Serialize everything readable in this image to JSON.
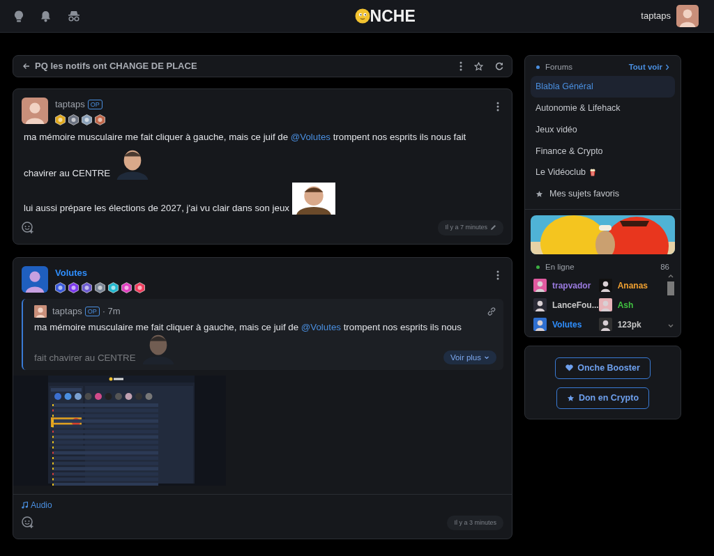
{
  "header": {
    "logo_text": "NCHE",
    "username": "taptaps"
  },
  "topic": {
    "title": "PQ les notifs ont CHANGE DE PLACE"
  },
  "posts": [
    {
      "author": "taptaps",
      "color": "#9ea3ab",
      "op": "OP",
      "badges": [
        {
          "color": "#e0a81c"
        },
        {
          "color": "#6b7280"
        },
        {
          "color": "#8aa0b8"
        },
        {
          "color": "#c0674a"
        }
      ],
      "lines": [
        [
          {
            "kind": "text",
            "text": "ma mémoire musculaire me fait cliquer à gauche, mais ce juif de "
          },
          {
            "kind": "mention",
            "text": "@Volutes"
          },
          {
            "kind": "text",
            "text": " trompent nos esprits ils nous fait"
          }
        ],
        [
          {
            "kind": "text",
            "text": "chavirer au CENTRE"
          },
          {
            "kind": "picture"
          }
        ],
        [
          {
            "kind": "text",
            "text": "lui aussi prépare les élections de 2027, j'ai vu clair dans son jeux"
          },
          {
            "kind": "picture"
          }
        ]
      ],
      "time": "Il y a 7 minutes",
      "edited": true
    },
    {
      "author": "Volutes",
      "color": "#2f8fff",
      "badges": [
        {
          "color": "#3b5bdb"
        },
        {
          "color": "#7c3aed"
        },
        {
          "color": "#6d5bd0"
        },
        {
          "color": "#7a8594"
        },
        {
          "color": "#22b8cf"
        },
        {
          "color": "#e040c0"
        },
        {
          "color": "#f03e5e"
        }
      ],
      "quote": {
        "author": "taptaps",
        "op": "OP",
        "age": "· 7m",
        "lines": [
          [
            {
              "kind": "text",
              "text": "ma mémoire musculaire me fait cliquer à gauche, mais ce juif de "
            },
            {
              "kind": "mention",
              "text": "@Volutes"
            },
            {
              "kind": "text",
              "text": " trompent nos esprits ils nous"
            }
          ],
          [
            {
              "kind": "text",
              "text": "fait chavirer au CENTRE"
            },
            {
              "kind": "picture"
            }
          ]
        ],
        "more": "Voir plus"
      },
      "attachment": {
        "kind": "screenshot"
      },
      "audio": "Audio",
      "time": "Il y a 3 minutes",
      "edited": false
    }
  ],
  "forums": {
    "title": "Forums",
    "see_all": "Tout voir",
    "items": [
      {
        "label": "Blabla Général",
        "selected": true,
        "kind": "plain"
      },
      {
        "label": "Autonomie & Lifehack",
        "selected": false,
        "kind": "plain"
      },
      {
        "label": "Jeux vidéo",
        "selected": false,
        "kind": "plain"
      },
      {
        "label": "Finance & Crypto",
        "selected": false,
        "kind": "plain"
      },
      {
        "label": "Le Vidéoclub",
        "selected": false,
        "kind": "popcorn"
      },
      {
        "label": "Mes sujets favoris",
        "selected": false,
        "kind": "starred"
      }
    ]
  },
  "banner": {
    "kind": "picture"
  },
  "online": {
    "title": "En ligne",
    "count": "86",
    "users": [
      {
        "name": "trapvador",
        "color": "#9b7be0"
      },
      {
        "name": "Ananas",
        "color": "#f0a030"
      },
      {
        "name": "LanceFou...",
        "color": "#c8c8c8"
      },
      {
        "name": "Ash",
        "color": "#40c040"
      },
      {
        "name": "Volutes",
        "color": "#2f8fff"
      },
      {
        "name": "123pk",
        "color": "#c8c8c8"
      }
    ]
  },
  "support_buttons": [
    {
      "label": "Onche Booster",
      "kind": "heart"
    },
    {
      "label": "Don en Crypto",
      "kind": "star"
    }
  ]
}
